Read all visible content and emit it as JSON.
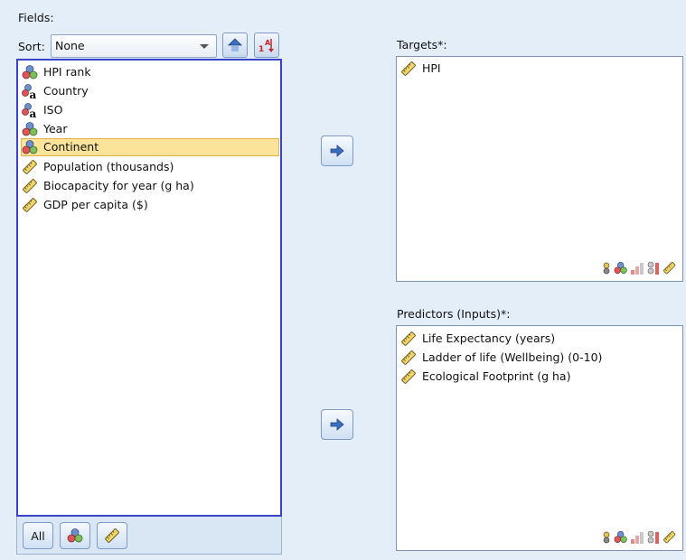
{
  "fields": {
    "label": "Fields:",
    "sort_label": "Sort:",
    "sort_value": "None",
    "items": [
      {
        "label": "HPI rank",
        "icon": "nominal-icon"
      },
      {
        "label": "Country",
        "icon": "nominal-string-icon"
      },
      {
        "label": "ISO",
        "icon": "nominal-string-icon"
      },
      {
        "label": "Year",
        "icon": "nominal-icon"
      },
      {
        "label": "Continent",
        "icon": "nominal-icon",
        "selected": true
      },
      {
        "label": "Population (thousands)",
        "icon": "scale-icon"
      },
      {
        "label": "Biocapacity for year (g ha)",
        "icon": "scale-icon"
      },
      {
        "label": "GDP per capita ($)",
        "icon": "scale-icon"
      }
    ],
    "footer": {
      "all_label": "All"
    }
  },
  "targets": {
    "label": "Targets*:",
    "items": [
      {
        "label": "HPI",
        "icon": "scale-icon"
      }
    ]
  },
  "predictors": {
    "label": "Predictors (Inputs)*:",
    "items": [
      {
        "label": "Life Expectancy (years)",
        "icon": "scale-icon"
      },
      {
        "label": "Ladder of life (Wellbeing) (0-10)",
        "icon": "scale-icon"
      },
      {
        "label": "Ecological Footprint (g ha)",
        "icon": "scale-icon"
      }
    ]
  },
  "colors": {
    "background": "#e3eef9",
    "selection": "#fbe39a",
    "focus_border": "#3a42c7"
  }
}
